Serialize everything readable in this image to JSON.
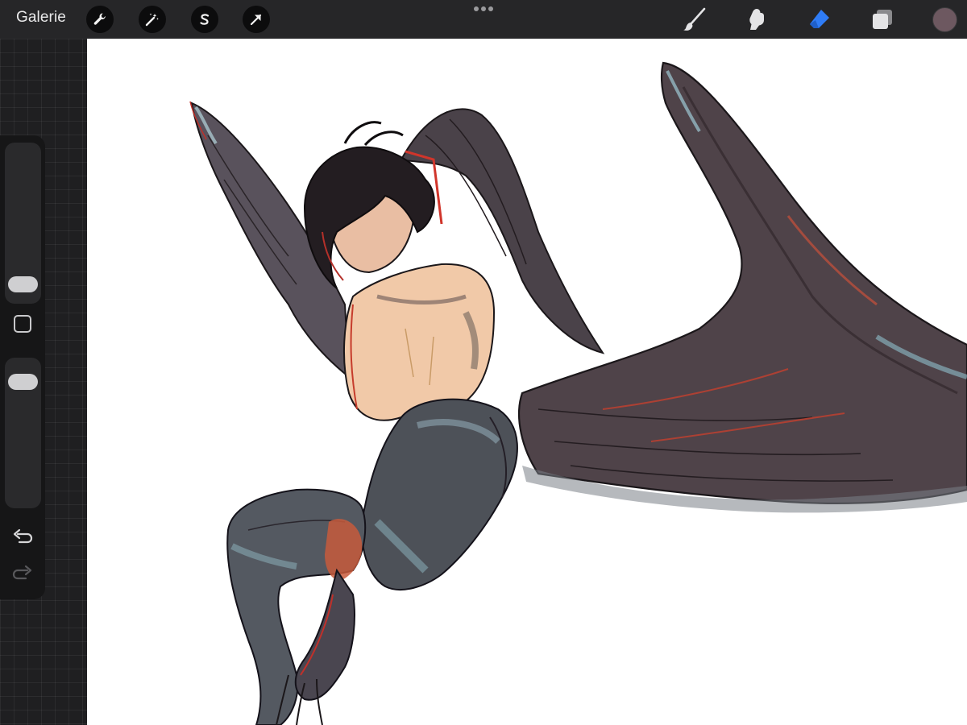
{
  "app": {
    "gallery_label": "Galerie"
  },
  "toolbar": {
    "left_tools": [
      "wrench-icon",
      "magic-wand-icon",
      "selection-s-icon",
      "transform-arrow-icon"
    ],
    "right_tools": [
      "brush-icon",
      "smudge-icon",
      "eraser-icon",
      "layers-icon"
    ],
    "active_tool": "eraser-icon",
    "active_color": "#6d5860",
    "accent_color": "#2f7cf6"
  },
  "sidebar": {
    "brush_size": 0.06,
    "brush_opacity": 0.9
  },
  "canvas": {
    "background": "#ffffff"
  }
}
